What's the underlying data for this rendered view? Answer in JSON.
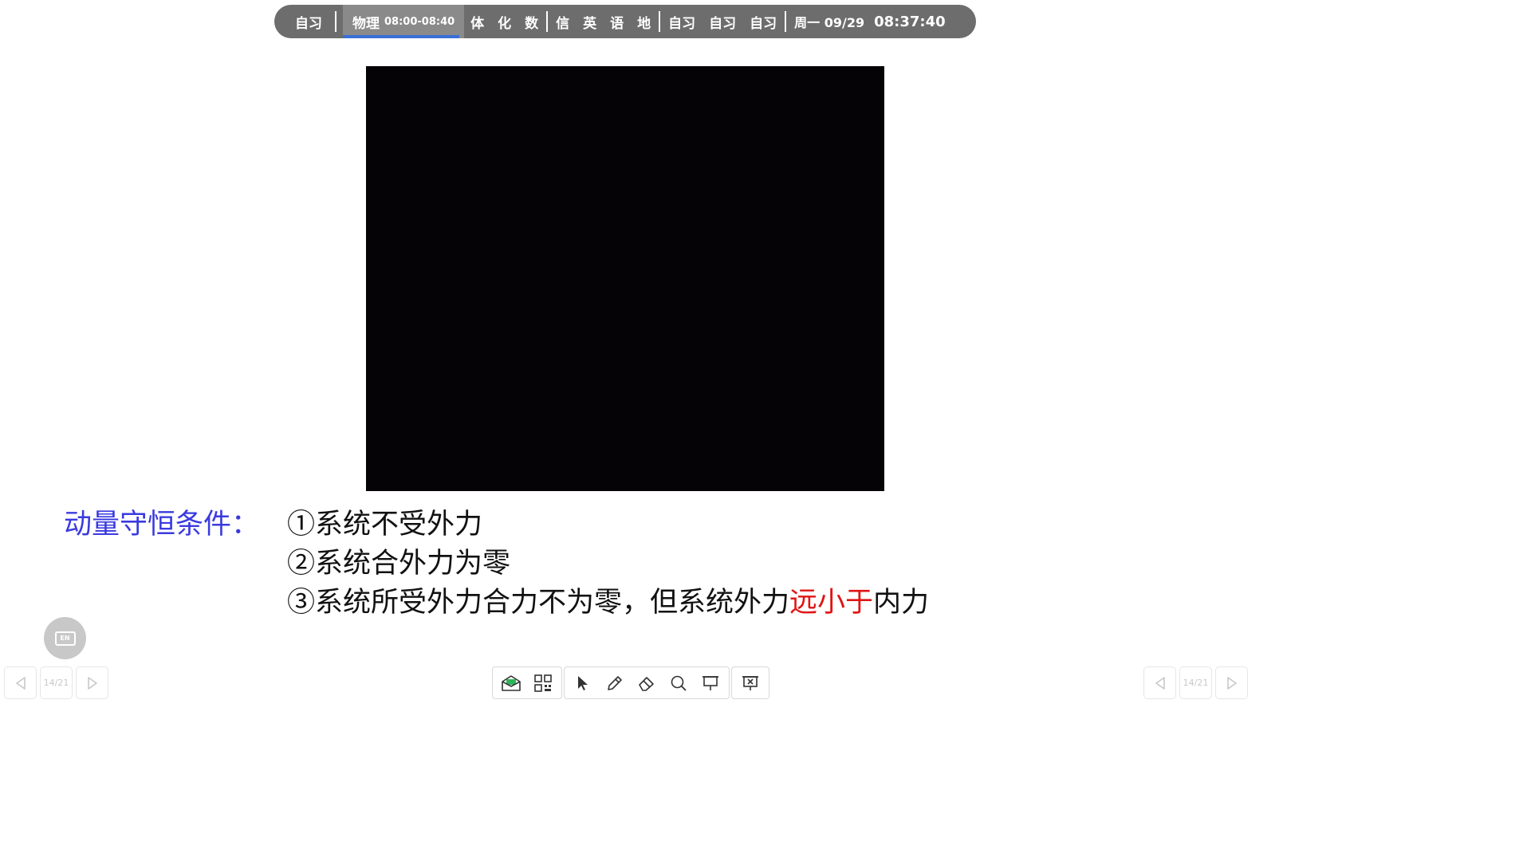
{
  "schedule_bar": {
    "before_current": "自习",
    "current_subject": "物理",
    "current_time": "08:00-08:40",
    "current_progress_percent": 96,
    "group1": [
      "体",
      "化",
      "数"
    ],
    "group2": [
      "信",
      "英",
      "语",
      "地"
    ],
    "group3": [
      "自习",
      "自习",
      "自习"
    ],
    "date": "周一 09/29",
    "clock": "08:37:40"
  },
  "slide": {
    "conditions_label": "动量守恒条件：",
    "condition_1": "①系统不受外力",
    "condition_2": "②系统合外力为零",
    "condition_3_prefix": "③系统所受外力合力不为零，但系统外力",
    "condition_3_highlight": "远小于",
    "condition_3_suffix": "内力"
  },
  "floating": {
    "en_label": "EN"
  },
  "pager_left": {
    "page_indicator": "14/21"
  },
  "pager_right": {
    "page_indicator": "14/21"
  },
  "toolbar": {
    "icons": [
      "message-icon",
      "qr-code-icon",
      "pointer-icon",
      "pen-icon",
      "eraser-icon",
      "search-icon",
      "presentation-icon",
      "close-slideshow-icon"
    ]
  },
  "colors": {
    "bar_bg": "#6d6d6d",
    "progress": "#3a6fd8",
    "label_blue": "#3a3ae0",
    "highlight_red": "#e01414"
  }
}
